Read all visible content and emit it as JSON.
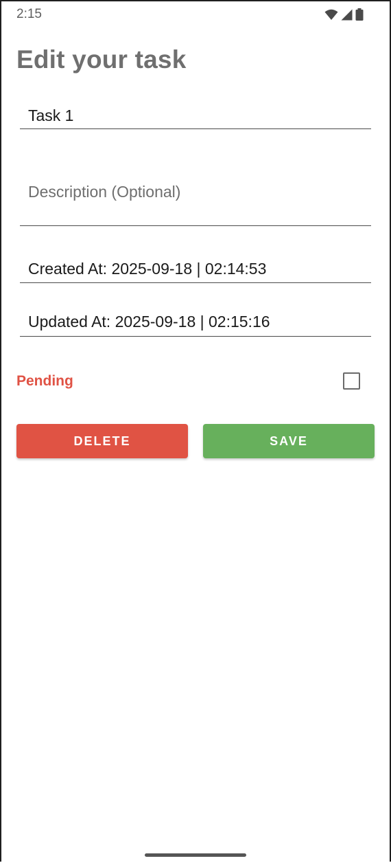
{
  "status_bar": {
    "time": "2:15",
    "icons": [
      "wifi-icon",
      "cell-signal-icon",
      "battery-icon"
    ]
  },
  "page": {
    "title": "Edit your task"
  },
  "form": {
    "title_value": "Task 1",
    "description_placeholder": "Description (Optional)",
    "created_at": "Created At: 2025-09-18 | 02:14:53",
    "updated_at": "Updated At: 2025-09-18 | 02:15:16",
    "status_label": "Pending",
    "status_checked": false
  },
  "actions": {
    "delete_label": "DELETE",
    "save_label": "SAVE"
  },
  "colors": {
    "title": "#6f6f6f",
    "pending": "#e05345",
    "delete": "#e05344",
    "save": "#67b05c"
  }
}
